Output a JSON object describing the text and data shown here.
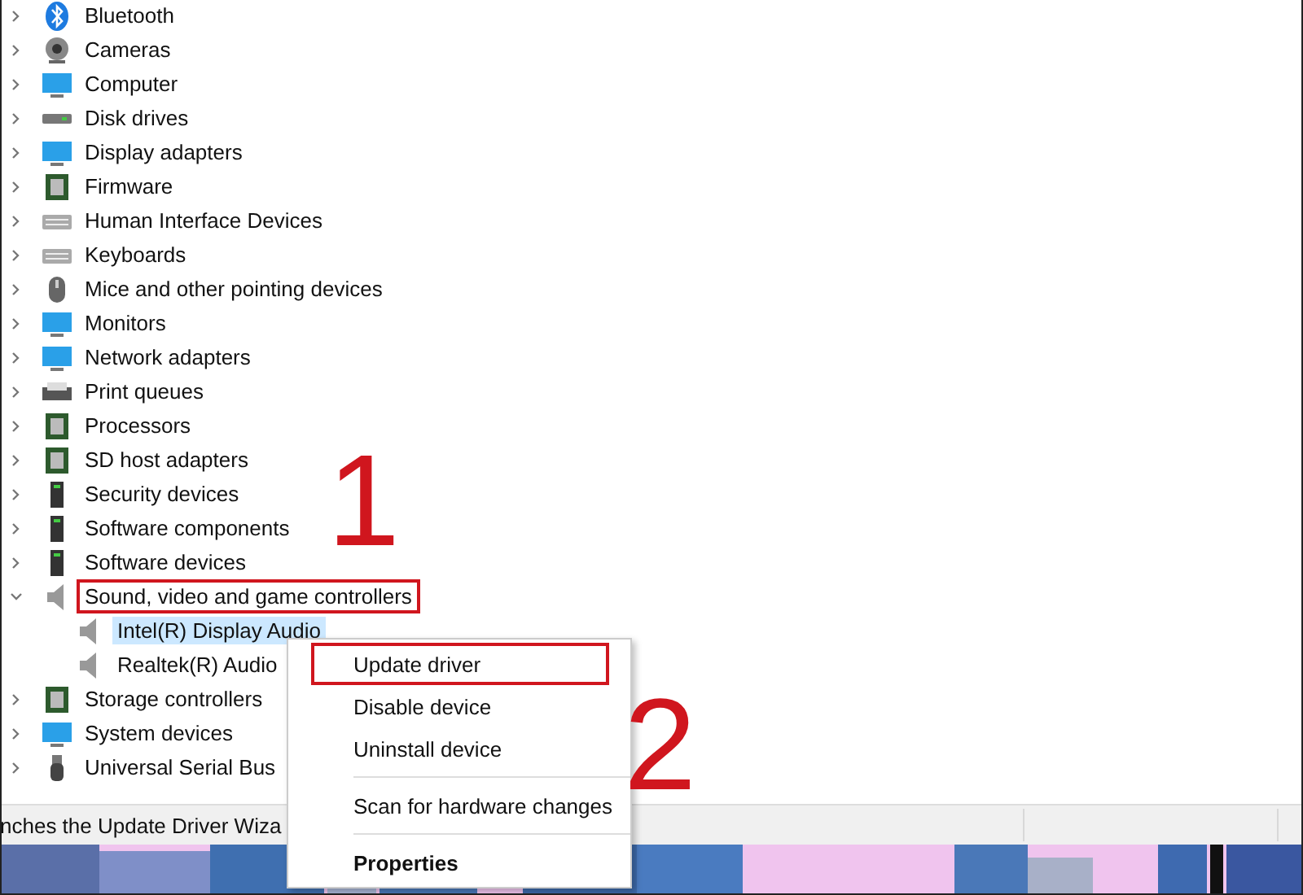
{
  "tree": [
    {
      "label": "Bluetooth",
      "expanded": false,
      "selected": false,
      "highlighted": false
    },
    {
      "label": "Cameras",
      "expanded": false,
      "selected": false,
      "highlighted": false
    },
    {
      "label": "Computer",
      "expanded": false,
      "selected": false,
      "highlighted": false
    },
    {
      "label": "Disk drives",
      "expanded": false,
      "selected": false,
      "highlighted": false
    },
    {
      "label": "Display adapters",
      "expanded": false,
      "selected": false,
      "highlighted": false
    },
    {
      "label": "Firmware",
      "expanded": false,
      "selected": false,
      "highlighted": false
    },
    {
      "label": "Human Interface Devices",
      "expanded": false,
      "selected": false,
      "highlighted": false
    },
    {
      "label": "Keyboards",
      "expanded": false,
      "selected": false,
      "highlighted": false
    },
    {
      "label": "Mice and other pointing devices",
      "expanded": false,
      "selected": false,
      "highlighted": false
    },
    {
      "label": "Monitors",
      "expanded": false,
      "selected": false,
      "highlighted": false
    },
    {
      "label": "Network adapters",
      "expanded": false,
      "selected": false,
      "highlighted": false
    },
    {
      "label": "Print queues",
      "expanded": false,
      "selected": false,
      "highlighted": false
    },
    {
      "label": "Processors",
      "expanded": false,
      "selected": false,
      "highlighted": false
    },
    {
      "label": "SD host adapters",
      "expanded": false,
      "selected": false,
      "highlighted": false
    },
    {
      "label": "Security devices",
      "expanded": false,
      "selected": false,
      "highlighted": false
    },
    {
      "label": "Software components",
      "expanded": false,
      "selected": false,
      "highlighted": false
    },
    {
      "label": "Software devices",
      "expanded": false,
      "selected": false,
      "highlighted": false
    },
    {
      "label": "Sound, video and game controllers",
      "expanded": true,
      "selected": false,
      "highlighted": true,
      "children": [
        {
          "label": "Intel(R) Display Audio",
          "selected": true
        },
        {
          "label": "Realtek(R) Audio",
          "selected": false
        }
      ]
    },
    {
      "label": "Storage controllers",
      "expanded": false,
      "selected": false,
      "highlighted": false
    },
    {
      "label": "System devices",
      "expanded": false,
      "selected": false,
      "highlighted": false
    },
    {
      "label": "Universal Serial Bus",
      "expanded": false,
      "selected": false,
      "highlighted": false
    }
  ],
  "status_bar": {
    "text": "nches the Update Driver Wiza"
  },
  "context_menu": [
    {
      "kind": "item",
      "label": "Update driver",
      "bold": false,
      "highlighted": true
    },
    {
      "kind": "item",
      "label": "Disable device",
      "bold": false,
      "highlighted": false
    },
    {
      "kind": "item",
      "label": "Uninstall device",
      "bold": false,
      "highlighted": false
    },
    {
      "kind": "separator"
    },
    {
      "kind": "item",
      "label": "Scan for hardware changes",
      "bold": false,
      "highlighted": false
    },
    {
      "kind": "separator"
    },
    {
      "kind": "item",
      "label": "Properties",
      "bold": true,
      "highlighted": false
    }
  ],
  "step_numbers": [
    {
      "text": "1"
    },
    {
      "text": "2"
    }
  ]
}
